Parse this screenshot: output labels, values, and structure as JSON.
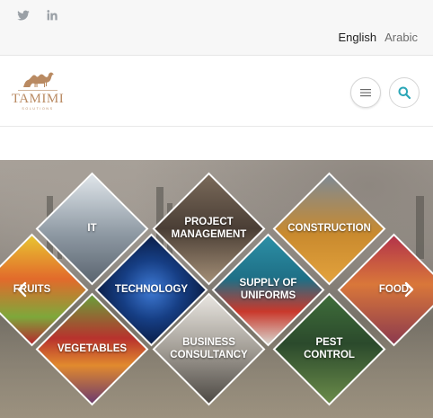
{
  "topbar": {
    "social": [
      {
        "icon": "twitter-icon"
      },
      {
        "icon": "linkedin-icon"
      }
    ],
    "languages": {
      "active": "English",
      "other": "Arabic"
    }
  },
  "header": {
    "logo": {
      "wordmark": "TAMIMI",
      "sub": "SOLUTIONS",
      "icon": "camel-icon"
    },
    "menu_icon": "hamburger-menu-icon",
    "search_icon": "search-icon",
    "accent_color": "#2aa6b7"
  },
  "hero": {
    "background": "city skyline",
    "tiles": [
      {
        "key": "it",
        "label": "IT"
      },
      {
        "key": "project-management",
        "label": "PROJECT\nMANAGEMENT"
      },
      {
        "key": "construction",
        "label": "CONSTRUCTION"
      },
      {
        "key": "fruits",
        "label": "FRUITS"
      },
      {
        "key": "technology",
        "label": "TECHNOLOGY"
      },
      {
        "key": "uniforms",
        "label": "SUPPLY OF\nUNIFORMS"
      },
      {
        "key": "food",
        "label": "FOOD"
      },
      {
        "key": "vegetables",
        "label": "VEGETABLES"
      },
      {
        "key": "business-consultancy",
        "label": "BUSINESS\nCONSULTANCY"
      },
      {
        "key": "pest-control",
        "label": "PEST CONTROL"
      }
    ],
    "prev_icon": "chevron-left-icon",
    "next_icon": "chevron-right-icon"
  }
}
